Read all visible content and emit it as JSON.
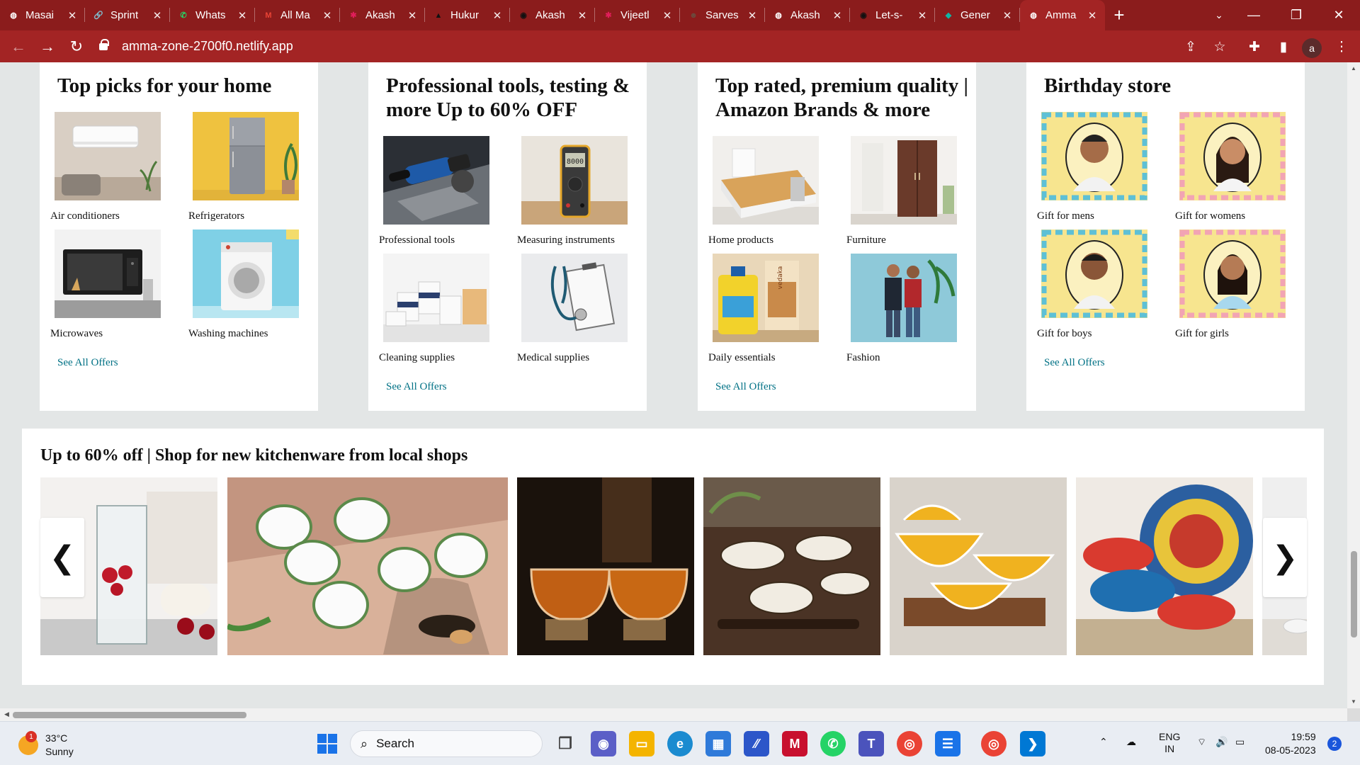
{
  "browser": {
    "tabs": [
      {
        "title": "Masai",
        "icon": "globe-icon",
        "color": "#ffffff",
        "glyph": "◍"
      },
      {
        "title": "Sprint",
        "icon": "link-icon",
        "color": "#8ab4f8",
        "glyph": "🔗"
      },
      {
        "title": "Whats",
        "icon": "whatsapp-icon",
        "color": "#25d366",
        "glyph": "✆"
      },
      {
        "title": "All Ma",
        "icon": "gmail-icon",
        "color": "#ea4335",
        "glyph": "M"
      },
      {
        "title": "Akash",
        "icon": "slack-icon",
        "color": "#e01e5a",
        "glyph": "✱"
      },
      {
        "title": "Hukur",
        "icon": "triangle-icon",
        "color": "#111111",
        "glyph": "▲"
      },
      {
        "title": "Akash",
        "icon": "github-icon",
        "color": "#111111",
        "glyph": "◉"
      },
      {
        "title": "Vijeetl",
        "icon": "slack-icon",
        "color": "#e01e5a",
        "glyph": "✱"
      },
      {
        "title": "Sarves",
        "icon": "avatar-icon",
        "color": "#6b4b3e",
        "glyph": "☻"
      },
      {
        "title": "Akash",
        "icon": "globe-icon",
        "color": "#ffffff",
        "glyph": "◍"
      },
      {
        "title": "Let-s-",
        "icon": "github-icon",
        "color": "#111111",
        "glyph": "◉"
      },
      {
        "title": "Gener",
        "icon": "diamond-icon",
        "color": "#10b5a5",
        "glyph": "◆"
      },
      {
        "title": "Amma",
        "icon": "globe-icon",
        "color": "#ffffff",
        "glyph": "◍",
        "active": true
      }
    ],
    "url": "amma-zone-2700f0.netlify.app",
    "profile_initial": "a"
  },
  "cards": [
    {
      "title": "Top picks for your home",
      "items": [
        {
          "label": "Air conditioners"
        },
        {
          "label": "Refrigerators"
        },
        {
          "label": "Microwaves"
        },
        {
          "label": "Washing machines"
        }
      ],
      "see_all": "See All Offers"
    },
    {
      "title": "Professional tools, testing & more Up to 60% OFF",
      "items": [
        {
          "label": "Professional tools"
        },
        {
          "label": "Measuring instruments"
        },
        {
          "label": "Cleaning supplies"
        },
        {
          "label": "Medical supplies"
        }
      ],
      "see_all": "See All Offers"
    },
    {
      "title": "Top rated, premium quality | Amazon Brands & more",
      "items": [
        {
          "label": "Home products"
        },
        {
          "label": "Furniture"
        },
        {
          "label": "Daily essentials"
        },
        {
          "label": "Fashion"
        }
      ],
      "see_all": "See All Offers"
    },
    {
      "title": "Birthday store",
      "items": [
        {
          "label": "Gift for mens"
        },
        {
          "label": "Gift for womens"
        },
        {
          "label": "Gift for boys"
        },
        {
          "label": "Gift for girls"
        }
      ],
      "see_all": "See All Offers"
    }
  ],
  "kitchen": {
    "title": "Up to 60% off | Shop for new kitchenware from local shops",
    "prev_glyph": "❮",
    "next_glyph": "❯"
  },
  "taskbar": {
    "weather_temp": "33°C",
    "weather_desc": "Sunny",
    "weather_badge": "1",
    "search_label": "Search",
    "lang_top": "ENG",
    "lang_bottom": "IN",
    "time": "19:59",
    "date": "08-05-2023",
    "notifications": "2"
  },
  "colors": {
    "accent_link": "#007185",
    "chrome": "#8b1c1c"
  }
}
